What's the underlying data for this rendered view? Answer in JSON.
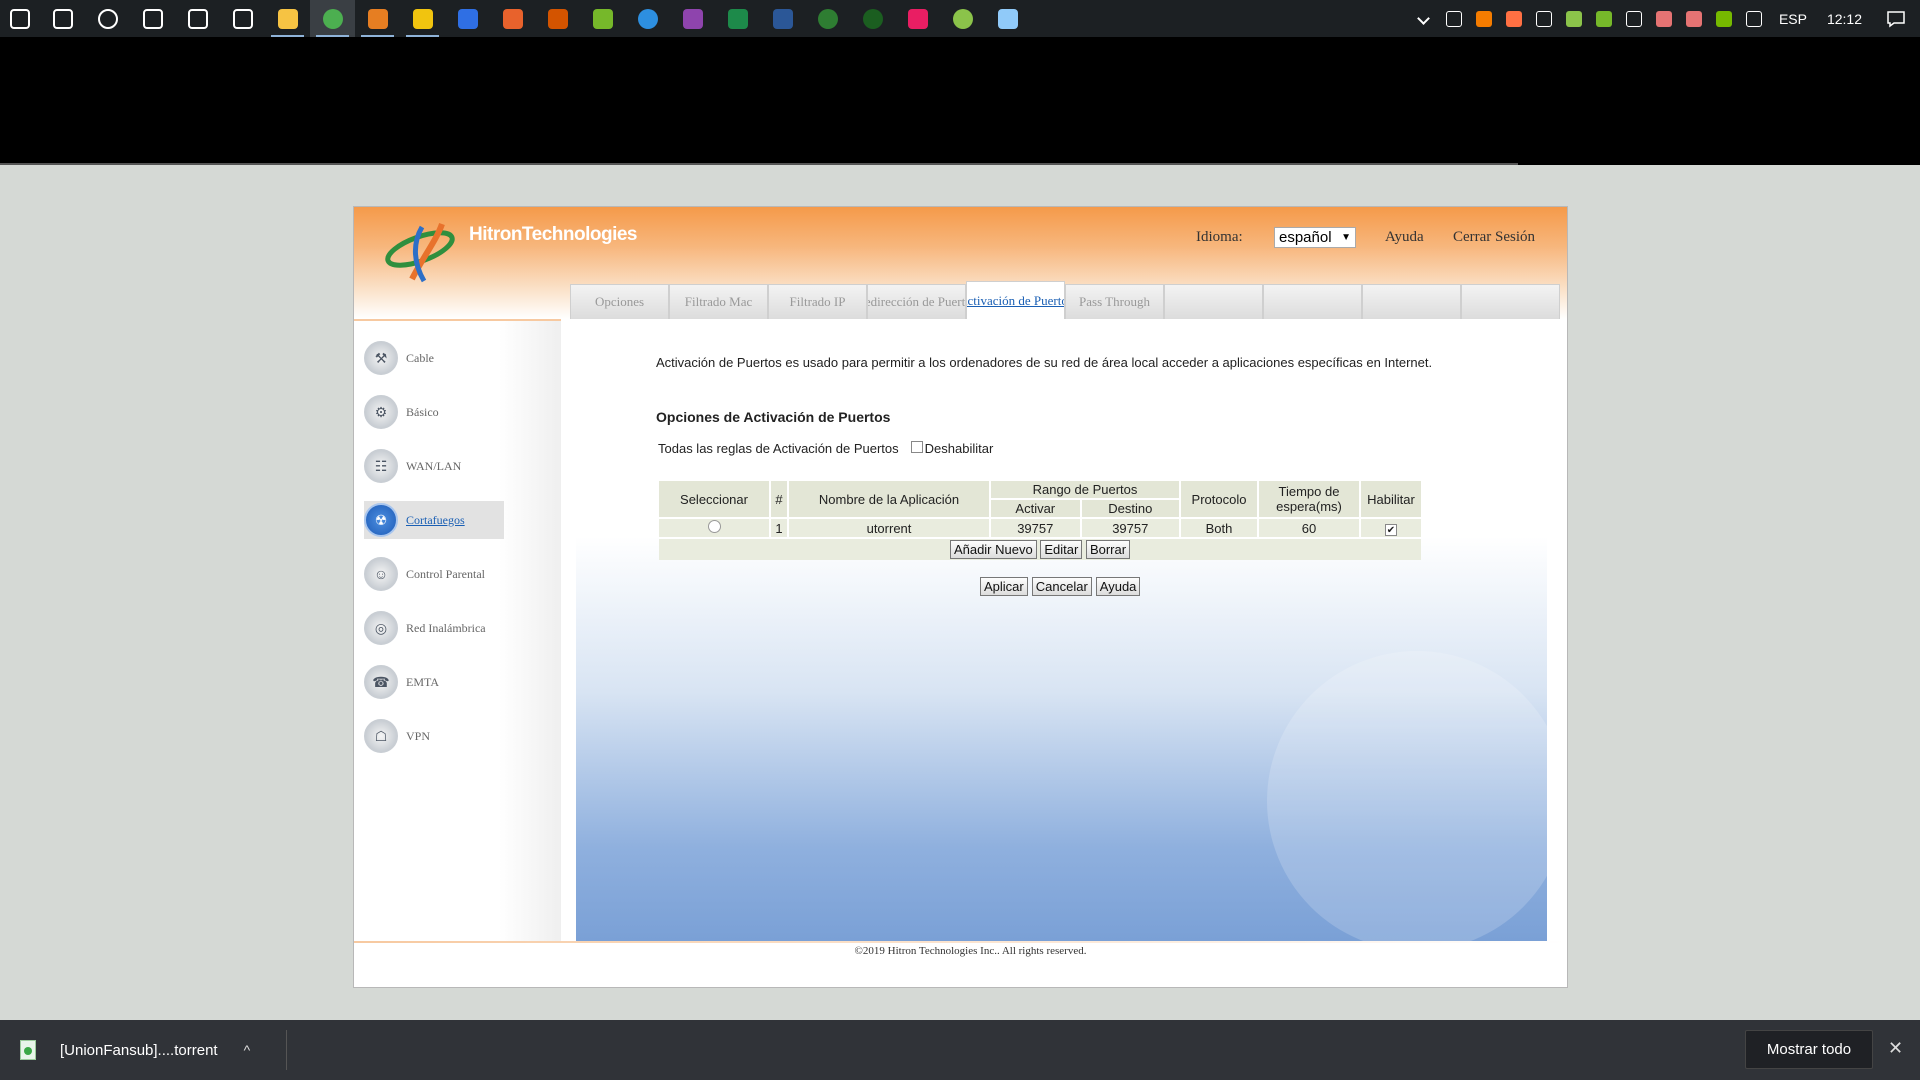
{
  "taskbar": {
    "apps": [
      {
        "name": "windows-start-icon",
        "color": "#ffffff"
      },
      {
        "name": "search-icon",
        "color": "#ffffff"
      },
      {
        "name": "cortana-icon",
        "color": "#ffffff"
      },
      {
        "name": "task-view-icon",
        "color": "#ffffff"
      },
      {
        "name": "mail-icon",
        "color": "#ffffff"
      },
      {
        "name": "store-icon",
        "color": "#ffffff"
      },
      {
        "name": "file-explorer-icon",
        "color": "#f6c343"
      },
      {
        "name": "chrome-icon",
        "color": "#4caf50"
      },
      {
        "name": "media-player-icon",
        "color": "#e67e22"
      },
      {
        "name": "video-editor-icon",
        "color": "#f1c40f"
      },
      {
        "name": "shield-app-icon",
        "color": "#2f6fe4"
      },
      {
        "name": "orange-app-icon",
        "color": "#e8622c"
      },
      {
        "name": "game-app-icon",
        "color": "#d35400"
      },
      {
        "name": "utorrent-icon",
        "color": "#76b82a"
      },
      {
        "name": "download-app-icon",
        "color": "#2d8fe0"
      },
      {
        "name": "photo-app-icon",
        "color": "#8e44ad"
      },
      {
        "name": "excel-icon",
        "color": "#1d8a4a"
      },
      {
        "name": "word-icon",
        "color": "#2b5797"
      },
      {
        "name": "green-ball-icon",
        "color": "#2e7d32"
      },
      {
        "name": "globe-app-icon",
        "color": "#1b5e20"
      },
      {
        "name": "dots-app-icon",
        "color": "#e91e63"
      },
      {
        "name": "utorrent-green-icon",
        "color": "#8bc34a"
      },
      {
        "name": "notepad-icon",
        "color": "#90caf9"
      }
    ],
    "tray": {
      "icons": [
        "chevron-up-icon",
        "usb-icon",
        "avast-icon",
        "orange-tray-icon",
        "shield-tray-icon",
        "utorrent-tray-icon",
        "utorrent-tray-icon-2",
        "volume-icon",
        "network-icon-1",
        "network-icon-2",
        "nvidia-icon",
        "display-icon"
      ],
      "language": "ESP",
      "time": "12:12"
    }
  },
  "router": {
    "brand": "HitronTechnologies",
    "language_label": "Idioma:",
    "language_value": "español",
    "help_link": "Ayuda",
    "logout_link": "Cerrar Sesión",
    "tabs": [
      {
        "label": "Opciones",
        "active": false
      },
      {
        "label": "Filtrado Mac",
        "active": false
      },
      {
        "label": "Filtrado IP",
        "active": false
      },
      {
        "label": "Redirección de Puertos",
        "active": false
      },
      {
        "label": "Activación de Puertos",
        "active": true
      },
      {
        "label": "Pass Through",
        "active": false
      },
      {
        "label": "",
        "active": false
      },
      {
        "label": "",
        "active": false
      },
      {
        "label": "",
        "active": false
      },
      {
        "label": "",
        "active": false
      }
    ],
    "sidebar": [
      {
        "label": "Cable",
        "icon": "wrench-icon",
        "glyph": "⚒",
        "active": false
      },
      {
        "label": "Básico",
        "icon": "gears-icon",
        "glyph": "⚙",
        "active": false
      },
      {
        "label": "WAN/LAN",
        "icon": "network-icon",
        "glyph": "☷",
        "active": false
      },
      {
        "label": "Cortafuegos",
        "icon": "firewall-icon",
        "glyph": "☢",
        "active": true
      },
      {
        "label": "Control Parental",
        "icon": "parents-icon",
        "glyph": "☺",
        "active": false
      },
      {
        "label": "Red Inalámbrica",
        "icon": "wireless-icon",
        "glyph": "◎",
        "active": false
      },
      {
        "label": "EMTA",
        "icon": "phone-icon",
        "glyph": "☎",
        "active": false
      },
      {
        "label": "VPN",
        "icon": "vpn-lock-icon",
        "glyph": "☖",
        "active": false
      }
    ],
    "content": {
      "intro": "Activación de Puertos es usado para permitir a los ordenadores de su red de área local acceder a aplicaciones específicas en Internet.",
      "section_title": "Opciones de Activación de Puertos",
      "all_rules_label": "Todas las reglas de Activación de Puertos",
      "disable_label": "Deshabilitar",
      "table": {
        "headers": {
          "select": "Seleccionar",
          "number": "#",
          "app_name": "Nombre de la Aplicación",
          "port_range": "Rango de Puertos",
          "trigger": "Activar",
          "destination": "Destino",
          "protocol": "Protocolo",
          "timeout": "Tiempo de espera(ms)",
          "enable": "Habilitar"
        },
        "rows": [
          {
            "number": "1",
            "app_name": "utorrent",
            "trigger": "39757",
            "destination": "39757",
            "protocol": "Both",
            "timeout": "60",
            "enabled": "✔"
          }
        ],
        "buttons": {
          "add": "Añadir Nuevo",
          "edit": "Editar",
          "delete": "Borrar"
        }
      },
      "actions": {
        "apply": "Aplicar",
        "cancel": "Cancelar",
        "help": "Ayuda"
      }
    },
    "copyright": "©2019 Hitron Technologies Inc.. All rights reserved."
  },
  "download_bar": {
    "file_name": "[UnionFansub]....torrent",
    "show_all": "Mostrar todo"
  }
}
